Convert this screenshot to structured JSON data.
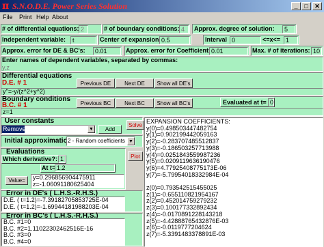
{
  "title": "S.N.O.D.E. Power Series Solution",
  "title_icon": "π",
  "title_buttons": [
    "_",
    "□",
    "✕"
  ],
  "menu": [
    "File",
    "Print",
    "Help",
    "About"
  ],
  "row1": {
    "num_de_label": "# of differential equations:",
    "num_de_value": "2",
    "num_bc_label": "# of boundary conditions:",
    "num_bc_value": "4",
    "degree_label": "Approx. degree of solution:",
    "degree_value": "5"
  },
  "row2": {
    "indep_label": "Independent variable:",
    "indep_value": "t",
    "center_label": "Center of expansion:",
    "center_value": "0.5",
    "interval_label": "Interval",
    "interval_from": "0",
    "interval_op": "<=x<=",
    "interval_to": "1"
  },
  "row3": {
    "err_de_label": "Approx. error for DE & BC's:",
    "err_de_value": "0.01",
    "err_coef_label": "Approx. error for Coefficients:",
    "err_coef_value": "0.01",
    "max_iter_label": "Max. # of iterations:",
    "max_iter_value": "10"
  },
  "dep_vars": {
    "label": "Enter names of dependent variables, separated by commas:",
    "value": "y,z"
  },
  "de": {
    "header": "Differential equations",
    "current": "D.E. # 1",
    "prev": "Previous DE",
    "next": "Next DE",
    "show_all": "Show all DE's",
    "equation": "y''=-y/(z^2+y^2)"
  },
  "bc": {
    "header": "Boundary conditions",
    "current": "B.C. # 1",
    "prev": "Previous BC",
    "next": "Next BC",
    "show_all": "Show all BC's",
    "evaluated_label": "Evaluated at t=",
    "evaluated_value": "0",
    "condition": "z=1"
  },
  "user_constants": {
    "header": "User constants",
    "select_value": "Remove",
    "add": "Add"
  },
  "solve": "Solve",
  "initial_approx": {
    "label": "Initial approximation",
    "value": "2 - Random coefficients"
  },
  "evaluations": {
    "header": "Evaluations",
    "which_deriv_label": "Which derivative?:",
    "which_deriv_value": "1",
    "plot": "Plot",
    "at_t_label": "At t=",
    "at_t_value": "1.2",
    "value_button": "Value=",
    "results": [
      "y=0.296856904475911",
      "z=-1.06091180625404"
    ]
  },
  "error_de": {
    "header": "Error in DE's  ( L.H.S.-R.H.S.)",
    "lines": [
      "D.E. ( t=1.2)=-7.39182705853725E-04",
      "D.E. ( t=1.2)=-1.69944181988203E-04"
    ]
  },
  "error_bc": {
    "header": "Error in BC's  ( L.H.S.-R.H.S.)",
    "lines": [
      "B.C. #1=0",
      "B.C. #2=1.11022302462516E-16",
      "B.C. #3=0",
      "B.C. #4=0"
    ]
  },
  "coefficients": {
    "header": "EXPANSION COEFFICIENTS:",
    "y": [
      "y(0)=0.498503447482754",
      "y(1)=0.902199442059163",
      "y(2)=-0.283707485512837",
      "y(3)=-0.186503257713988",
      "y(4)=0.0251843559987236",
      "y(5)=0.0209119636190476",
      "y(6)=4.77925408775173E-06",
      "y(7)=-5.79954018332984E-04"
    ],
    "z": [
      "z(0)=0.793542515455025",
      "z(1)=-0.655110821954167",
      "z(2)=0.452014759279232",
      "z(3)=0.100177332892434",
      "z(4)=-0.0170891228143218",
      "z(5)=-4.42888765432876E-03",
      "z(6)=-0.0119777204624",
      "z(7)=-5.3391483378891E-03"
    ]
  }
}
